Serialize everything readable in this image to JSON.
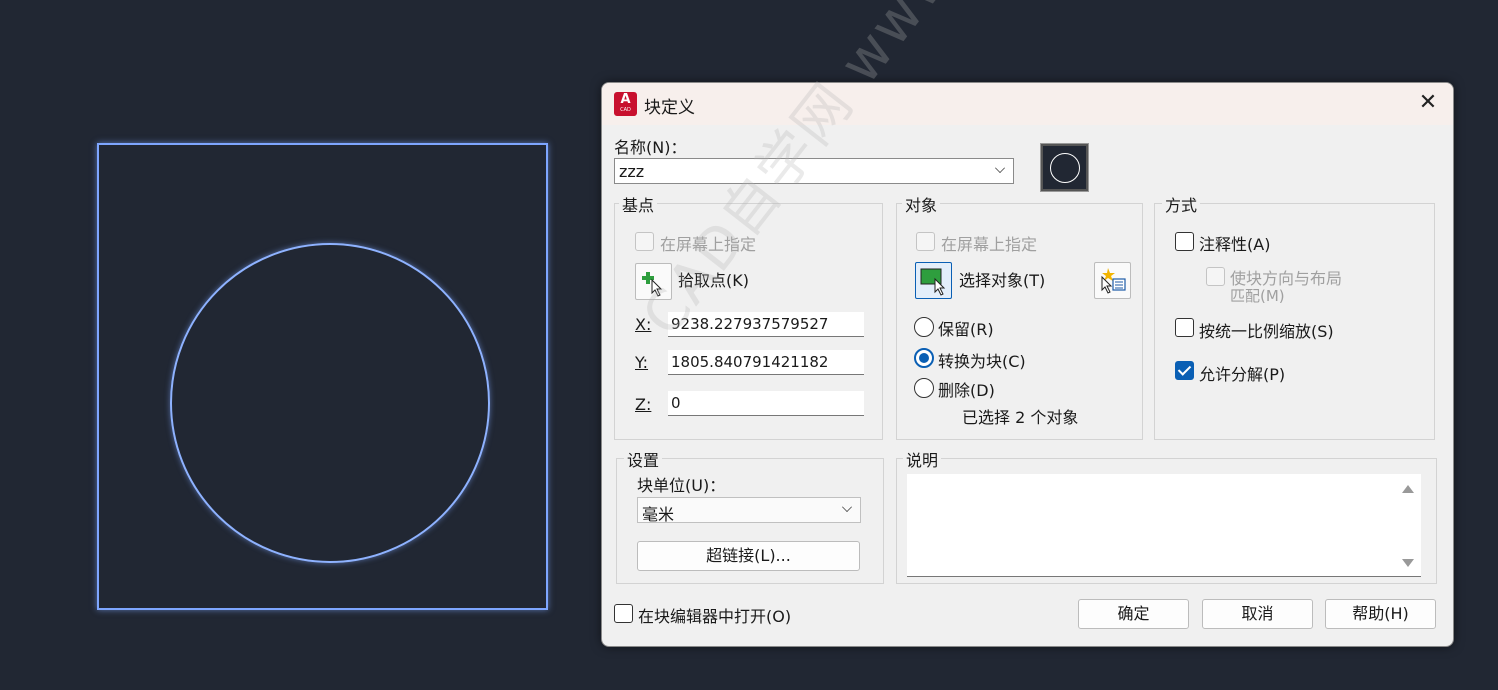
{
  "dialog": {
    "title": "块定义",
    "app_icon": "A",
    "app_icon_sub": "CAD",
    "close_icon": "✕"
  },
  "name": {
    "label": "名称(N)：",
    "value": "zzz"
  },
  "base_point": {
    "title": "基点",
    "specify_on_screen": "在屏幕上指定",
    "pick_point": "拾取点(K)",
    "x_label": "X:",
    "x_value": "9238.227937579527",
    "y_label": "Y:",
    "y_value": "1805.840791421182",
    "z_label": "Z:",
    "z_value": "0"
  },
  "objects": {
    "title": "对象",
    "specify_on_screen": "在屏幕上指定",
    "select_objects": "选择对象(T)",
    "retain": "保留(R)",
    "convert_to_block": "转换为块(C)",
    "delete": "删除(D)",
    "selected_count": "已选择 2 个对象",
    "selected_option": "convert_to_block"
  },
  "behavior": {
    "title": "方式",
    "annotative": "注释性(A)",
    "match_orientation_line1": "使块方向与布局",
    "match_orientation_line2": "匹配(M)",
    "scale_uniformly": "按统一比例缩放(S)",
    "allow_exploding": "允许分解(P)",
    "allow_exploding_checked": true
  },
  "settings": {
    "title": "设置",
    "block_unit_label": "块单位(U)：",
    "block_unit_value": "毫米",
    "hyperlink": "超链接(L)..."
  },
  "description": {
    "title": "说明"
  },
  "footer": {
    "open_in_editor": "在块编辑器中打开(O)",
    "ok": "确定",
    "cancel": "取消",
    "help": "帮助(H)"
  },
  "watermark": "CAD自学网 www.cadzxw.com",
  "colors": {
    "accent": "#0a5fb4",
    "canvas": "#212733",
    "shape": "#8eb2ff"
  }
}
